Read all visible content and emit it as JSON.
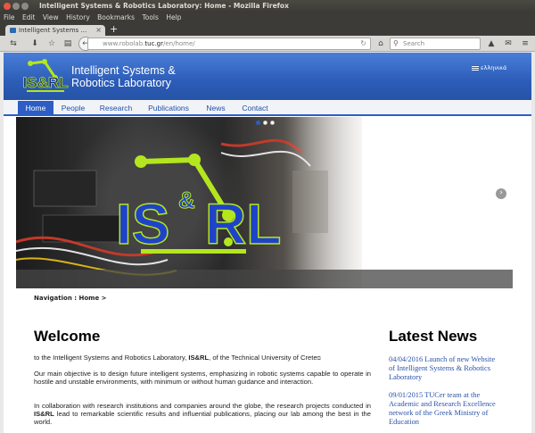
{
  "window": {
    "title": "Intelligent Systems & Robotics Laboratory: Home - Mozilla Firefox"
  },
  "menu": [
    "File",
    "Edit",
    "View",
    "History",
    "Bookmarks",
    "Tools",
    "Help"
  ],
  "tab": {
    "label": "Intelligent Systems ...",
    "new_tab": "+"
  },
  "toolbar": {
    "url_prefix": "www.robolab.",
    "url_host": "tuc.gr",
    "url_path": "/en/home/",
    "search_placeholder": "Search"
  },
  "site": {
    "logo_text": "IS&RL",
    "title_line1": "Intelligent Systems &",
    "title_line2": "Robotics Laboratory",
    "language_link": "ελληνικά",
    "nav": [
      "Home",
      "People",
      "Research",
      "Publications",
      "News",
      "Contact"
    ],
    "active_nav": "Home"
  },
  "slider": {
    "logo_text_left": "IS",
    "logo_text_amp": "&",
    "logo_text_right": "RL",
    "dots": 3,
    "active_dot": 1,
    "next_arrow": "›"
  },
  "breadcrumb": {
    "label": "Navigation :",
    "current": "Home",
    "sep": ">"
  },
  "welcome": {
    "title": "Welcome",
    "p1_a": "to the Intelligent Systems and Robotics Laboratory, ",
    "p1_b": "IS&RL",
    "p1_c": ", of the Technical University of Crete",
    "p2": "Our main objective is to design future intelligent systems, emphasizing in robotic systems capable to operate in hostile and unstable environments, with minimum or without human guidance and interaction.",
    "p3_a": "In collaboration with research institutions and companies around the globe, the research projects conducted in ",
    "p3_b": "IS&RL",
    "p3_c": " lead to remarkable scientific results and influential publications, placing our lab among the best in the world."
  },
  "news": {
    "title": "Latest News",
    "items": [
      "04/04/2016 Launch of new Website of Intelligent Systems & Robotics Laboratory",
      "09/01/2015 TUCer team at the Academic and Research Excellence network of the Greek Ministry of Education"
    ]
  },
  "colors": {
    "header_blue": "#2c5db8",
    "nav_blue": "#2d5ec6",
    "logo_green": "#b4e61e",
    "logo_blue": "#1f43c8",
    "news_link": "#2b53a8"
  }
}
